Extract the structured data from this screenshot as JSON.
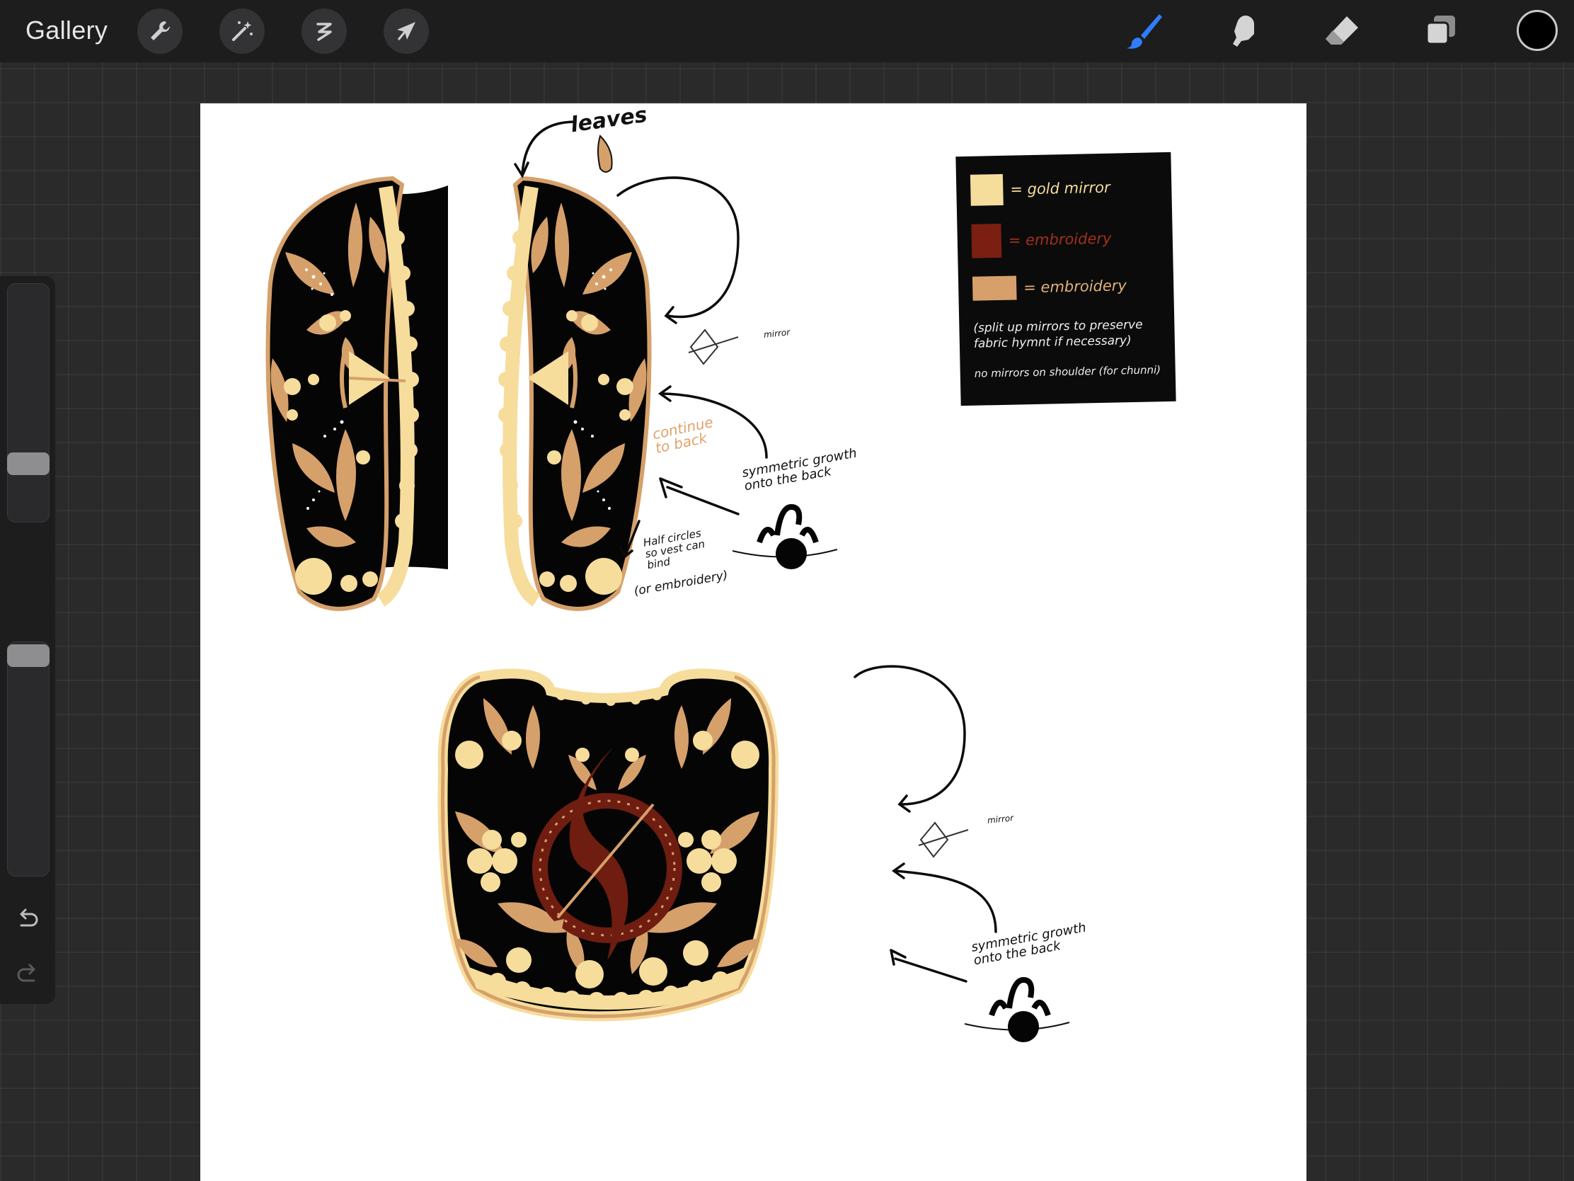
{
  "app": {
    "gallery_label": "Gallery"
  },
  "toolbar": {
    "left_tools": [
      {
        "name": "actions",
        "icon": "wrench-icon"
      },
      {
        "name": "adjustments",
        "icon": "magic-wand-icon"
      },
      {
        "name": "selection",
        "icon": "selection-s-icon"
      },
      {
        "name": "transform",
        "icon": "arrow-cursor-icon"
      }
    ],
    "right_tools": [
      {
        "name": "brush",
        "icon": "brush-icon",
        "active": true
      },
      {
        "name": "smudge",
        "icon": "smudge-finger-icon",
        "active": false
      },
      {
        "name": "eraser",
        "icon": "eraser-icon",
        "active": false
      },
      {
        "name": "layers",
        "icon": "layers-icon",
        "active": false
      }
    ],
    "current_color": "#000000",
    "accent_color": "#2f7dfb"
  },
  "sidebar": {
    "brush_size_level": 0.22,
    "opacity_level": 1.0
  },
  "canvas": {
    "notes": {
      "leaves": "leaves",
      "continue_to_back": "continue to back",
      "symmetric_1": "symmetric growth onto the back",
      "symmetric_2": "symmetric growth onto the back",
      "half_circles": "Half circles so vest can bind",
      "or_embroidery": "(or embroidery)",
      "mirror_1": "mirror",
      "mirror_2": "mirror"
    },
    "legend": {
      "rows": [
        {
          "label": "= gold mirror",
          "swatch": "#f5dd9b",
          "text_color": "#f5dd9b"
        },
        {
          "label": "= embroidery",
          "swatch": "#7a1f12",
          "text_color": "#a0321c"
        },
        {
          "label": "= embroidery",
          "swatch": "#d7a06a",
          "text_color": "#e2b07a"
        }
      ],
      "note_1": "(split up mirrors to preserve fabric hymnt if necessary)",
      "note_2": "no mirrors on shoulder (for chunni)"
    },
    "palette": {
      "black": "#050505",
      "tan": "#d6a06b",
      "cream": "#f6dd9c",
      "maroon": "#6e1d10"
    }
  }
}
